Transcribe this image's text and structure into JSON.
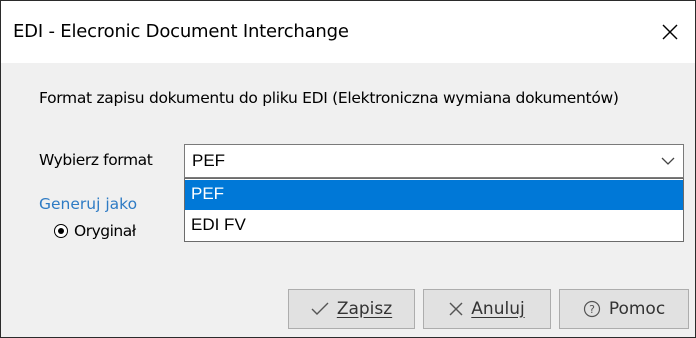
{
  "dialog": {
    "title": "EDI - Elecronic Document Interchange",
    "description": "Format zapisu dokumentu do pliku EDI (Elektroniczna wymiana dokumentów)"
  },
  "format": {
    "label": "Wybierz format",
    "selected_value": "PEF",
    "options": [
      {
        "label": "PEF",
        "highlighted": true
      },
      {
        "label": "EDI FV",
        "highlighted": false
      }
    ]
  },
  "generate": {
    "label": "Generuj jako",
    "radio_label": "Oryginał",
    "radio_checked": true
  },
  "buttons": {
    "save_label": "Zapisz",
    "cancel_label": "Anuluj",
    "help_label": "Pomoc"
  },
  "colors": {
    "highlight": "#0078d7",
    "link_blue": "#2e7bc4",
    "button_bg": "#e1e1e1",
    "dialog_bg": "#f0f0f0"
  },
  "icons": {
    "close": "close-icon",
    "chevron": "chevron-down-icon",
    "save": "checkmark-icon",
    "cancel": "x-icon",
    "help": "question-circle-icon"
  }
}
